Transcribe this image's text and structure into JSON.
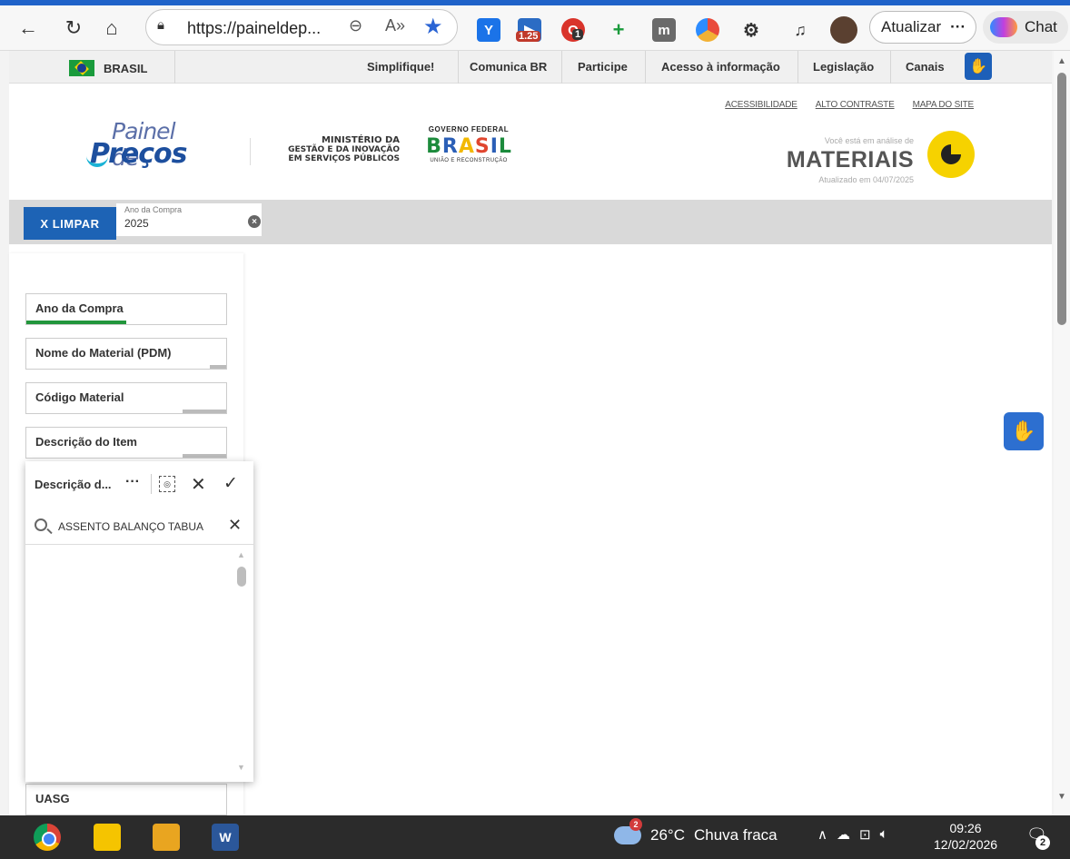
{
  "browser": {
    "url": "https://paineldep...",
    "update_label": "Atualizar",
    "more_label": "···",
    "chat_label": "Chat",
    "ext_badge_1": "1.25",
    "ext_badge_2": "1"
  },
  "govbar": {
    "country": "BRASIL",
    "links": [
      "Simplifique!",
      "Comunica BR",
      "Participe",
      "Acesso à informação",
      "Legislação",
      "Canais"
    ]
  },
  "header": {
    "top_links": [
      "ACESSIBILIDADE",
      "ALTO CONTRASTE",
      "MAPA DO SITE"
    ],
    "logo_line1": "Painel de",
    "logo_line2": "Preços",
    "ministry_line1": "MINISTÉRIO DA",
    "ministry_line2": "GESTÃO E DA INOVAÇÃO",
    "ministry_line3": "EM SERVIÇOS PÚBLICOS",
    "gov_federal": "GOVERNO FEDERAL",
    "gov_brasil": "BRASIL",
    "gov_slogan": "UNIÃO E RECONSTRUÇÃO",
    "analysis_caption": "Você está em análise de",
    "analysis_title": "MATERIAIS",
    "updated": "Atualizado em 04/07/2025"
  },
  "filterbar": {
    "clear_label": "X LIMPAR",
    "chip_label": "Ano da Compra",
    "chip_value": "2025"
  },
  "filters": {
    "items": [
      {
        "label": "Ano da Compra"
      },
      {
        "label": "Nome do Material (PDM)"
      },
      {
        "label": "Código Material"
      },
      {
        "label": "Descrição do Item"
      },
      {
        "label": "UASG"
      }
    ]
  },
  "dropdown": {
    "title": "Descrição d...",
    "search_value": "ASSENTO BALANÇO TABUA"
  },
  "taskbar": {
    "temperature": "26°C",
    "weather": "Chuva fraca",
    "weather_badge": "2",
    "time": "09:26",
    "date": "12/02/2026",
    "notif_count": "2"
  },
  "colors": {
    "brand_blue": "#1d63b5",
    "accent_yellow": "#f6d200",
    "selected_green": "#22963c"
  }
}
